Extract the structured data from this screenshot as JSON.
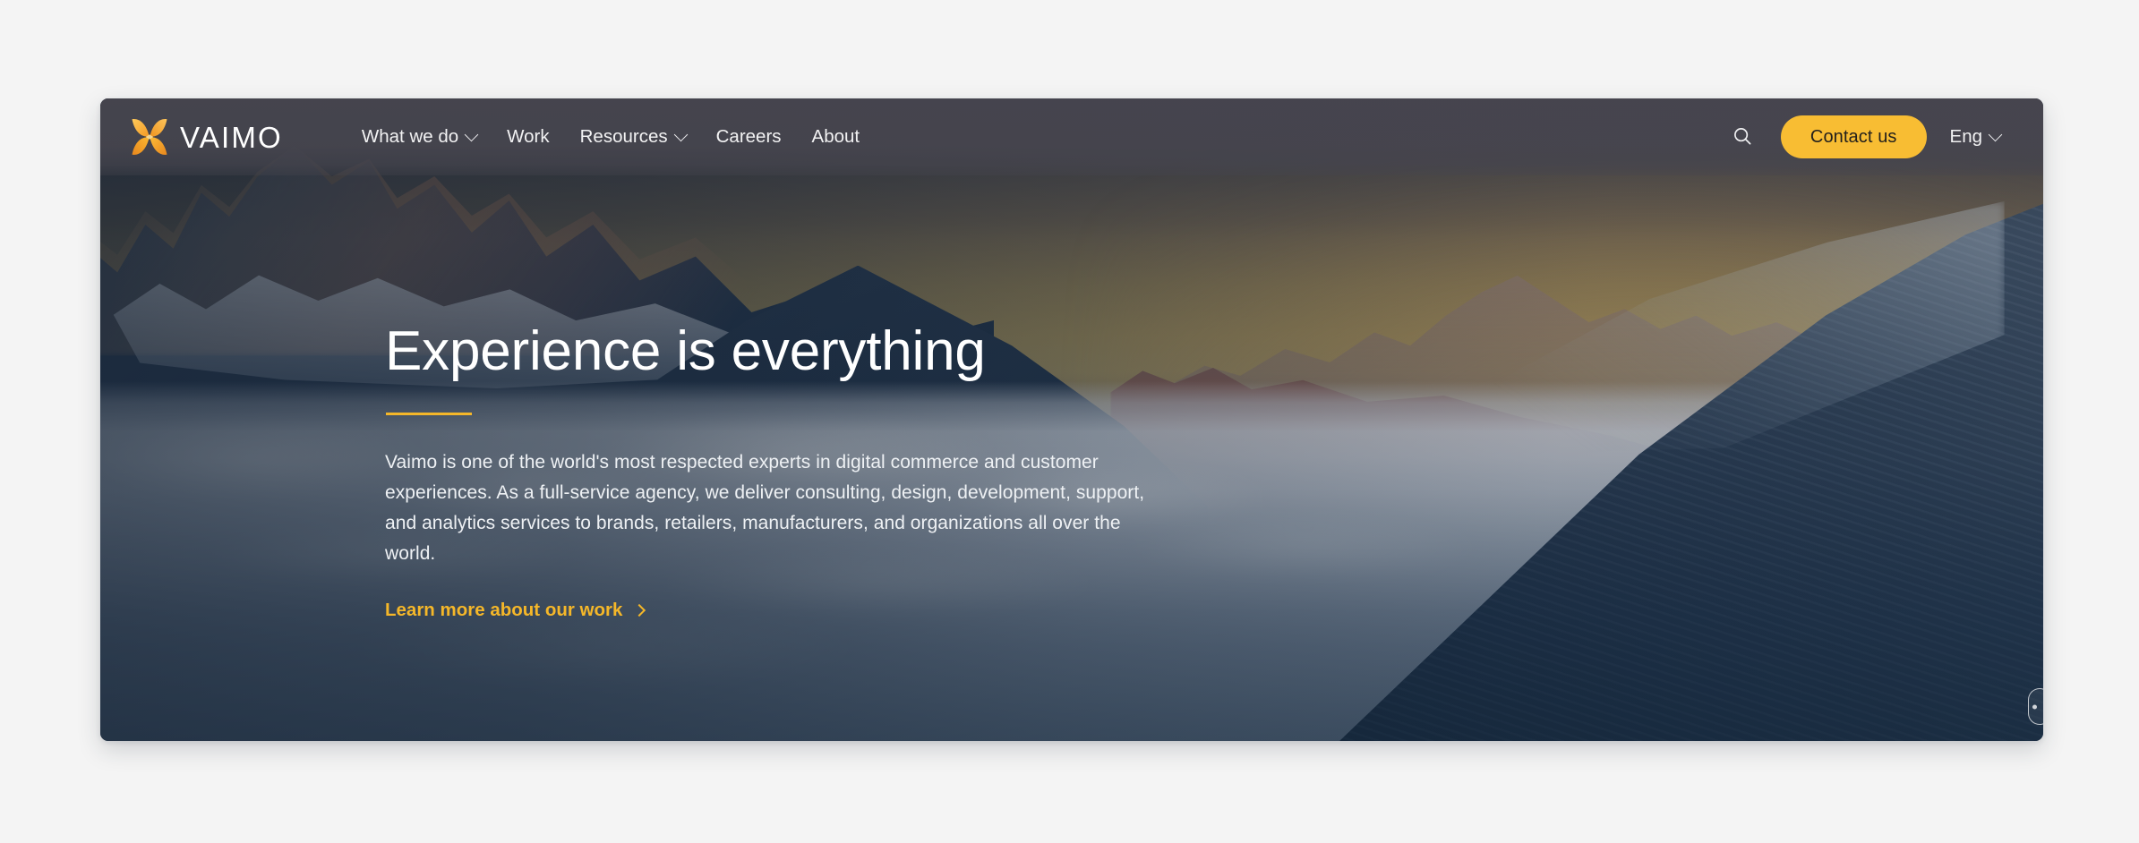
{
  "page": {
    "background_color": "#f4f4f4",
    "card_background_color": "#1d3346"
  },
  "header": {
    "background_color": "#46454e",
    "logo": {
      "mark_name": "vaimo-x-butterfly-logo",
      "wordmark": "VAIMO",
      "mark_colors": [
        "#fbb731",
        "#f59a24",
        "#fdc95a",
        "#e8871d"
      ]
    },
    "nav_items": [
      {
        "label": "What we do",
        "has_dropdown": true
      },
      {
        "label": "Work",
        "has_dropdown": false
      },
      {
        "label": "Resources",
        "has_dropdown": true
      },
      {
        "label": "Careers",
        "has_dropdown": false
      },
      {
        "label": "About",
        "has_dropdown": false
      }
    ],
    "search_icon": "search-icon",
    "cta": {
      "label": "Contact us",
      "background_color": "#f8bd33",
      "text_color": "#23201c"
    },
    "language": {
      "label": "Eng",
      "has_dropdown": true
    }
  },
  "hero": {
    "title": "Experience is everything",
    "rule_color": "#f5b729",
    "body": "Vaimo is one of the world's most respected experts in digital commerce and customer experiences. As a full-service agency, we deliver consulting, design, development, support, and analytics services to brands, retailers, manufacturers, and organizations all over the world.",
    "link": {
      "label": "Learn more about our work",
      "color": "#f5b729",
      "icon": "chevron-right-icon"
    },
    "image_description": "Alpine mountain range at sunrise above a sea of clouds"
  },
  "widget": {
    "name": "edge-tab-handle"
  }
}
